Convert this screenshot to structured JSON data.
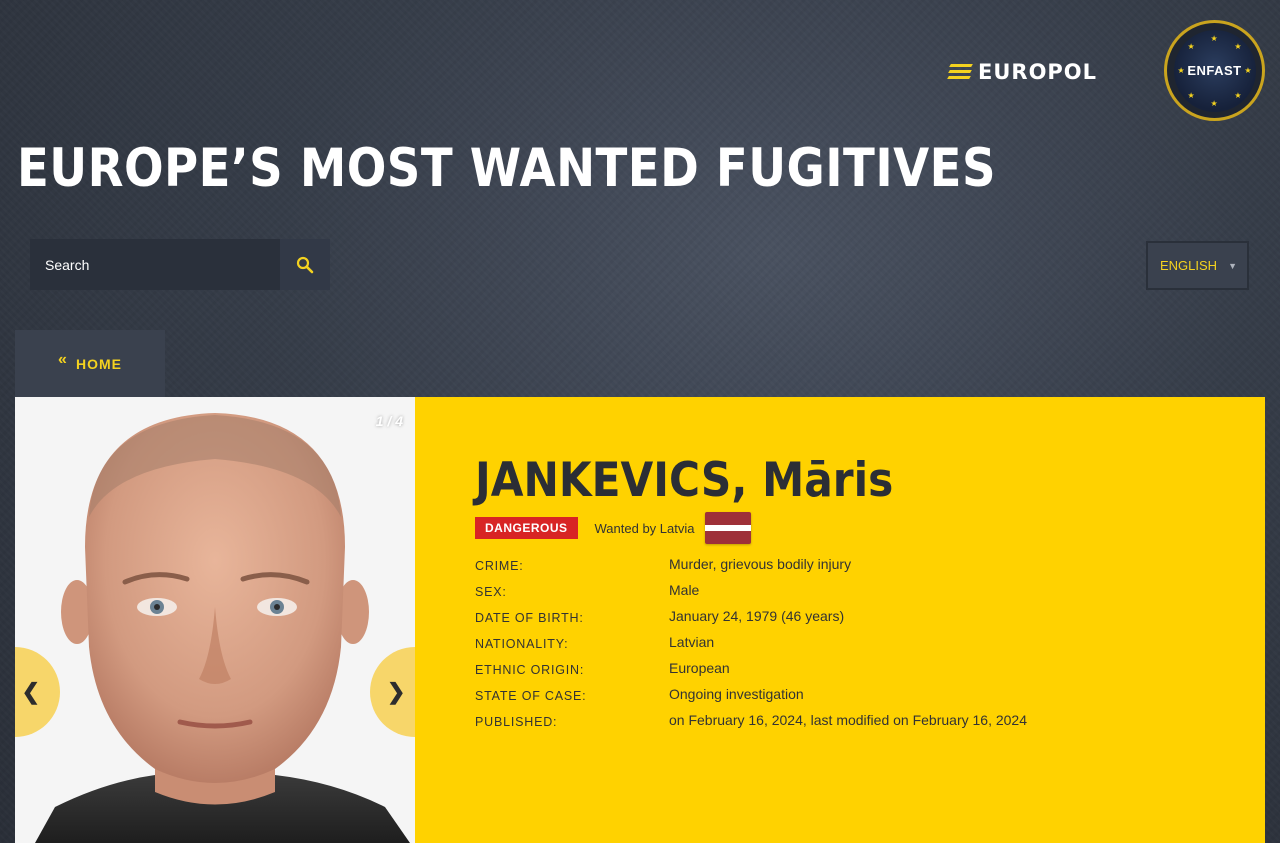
{
  "header": {
    "europol_logo_text": "EUROPOL",
    "enfast_logo_text": "ENFAST",
    "title": "EUROPE’S MOST WANTED FUGITIVES"
  },
  "search": {
    "placeholder": "Search"
  },
  "language": {
    "selected": "ENGLISH"
  },
  "nav": {
    "home_label": "HOME"
  },
  "gallery": {
    "counter": "1 / 4",
    "prev": "❮",
    "next": "❯"
  },
  "person": {
    "name": "JANKEVICS, Māris",
    "badge": "DANGEROUS",
    "wanted_by": "Wanted by Latvia",
    "flag_colors": {
      "red": "#9e3039",
      "white": "#ffffff"
    },
    "details": [
      {
        "label": "CRIME:",
        "value": "Murder, grievous bodily injury"
      },
      {
        "label": "SEX:",
        "value": "Male"
      },
      {
        "label": "DATE OF BIRTH:",
        "value": "January 24, 1979 (46 years)"
      },
      {
        "label": "NATIONALITY:",
        "value": "Latvian"
      },
      {
        "label": "ETHNIC ORIGIN:",
        "value": "European"
      },
      {
        "label": "STATE OF CASE:",
        "value": "Ongoing investigation"
      },
      {
        "label": "PUBLISHED:",
        "value": "on February 16, 2024, last modified on February 16, 2024"
      }
    ]
  },
  "colors": {
    "accent": "#ffd200",
    "badge_red": "#d82424",
    "background": "#363d49"
  }
}
